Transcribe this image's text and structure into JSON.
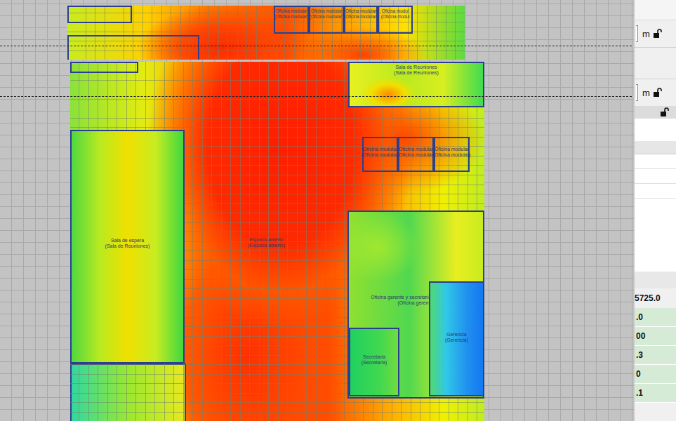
{
  "top_strip": {
    "rooms": [
      {
        "label": "Oficina modular",
        "sublabel": "(Oficina modular)"
      },
      {
        "label": "Oficina modular",
        "sublabel": "(Oficina modular)"
      },
      {
        "label": "Oficina modular",
        "sublabel": "(Oficina modular)"
      },
      {
        "label": "Oficina modul",
        "sublabel": "(Oficina modul"
      }
    ]
  },
  "floor_plan": {
    "rooms": [
      {
        "label": "Sala de Reuniones",
        "sublabel": "(Sala de Reuniones)",
        "kind": "room"
      },
      {
        "label": "Oficina modular",
        "sublabel": "(Oficina modular)",
        "kind": "room"
      },
      {
        "label": "Oficina modular",
        "sublabel": "(Oficina modular)",
        "kind": "room"
      },
      {
        "label": "Oficina modular",
        "sublabel": "(Oficina modular)",
        "kind": "room"
      },
      {
        "label": "Sala de espera",
        "sublabel": "(Sala de Reuniones)",
        "kind": "room"
      },
      {
        "label": "Espacio abierto",
        "sublabel": "(Espacio abierto)",
        "kind": "area"
      },
      {
        "label": "Oficina gerente y secretaria de planeador",
        "sublabel": "(Oficina gerente)",
        "kind": "room"
      },
      {
        "label": "Gerencia",
        "sublabel": "(Gerencia)",
        "kind": "room"
      },
      {
        "label": "Secretaria",
        "sublabel": "(Secretaria)",
        "kind": "room"
      }
    ]
  },
  "side_panel": {
    "fields": [
      {
        "unit": "m"
      },
      {
        "unit": "m"
      }
    ],
    "header_value": "5725.0",
    "values": [
      ".0",
      "00",
      ".3",
      "0",
      ".1"
    ]
  }
}
